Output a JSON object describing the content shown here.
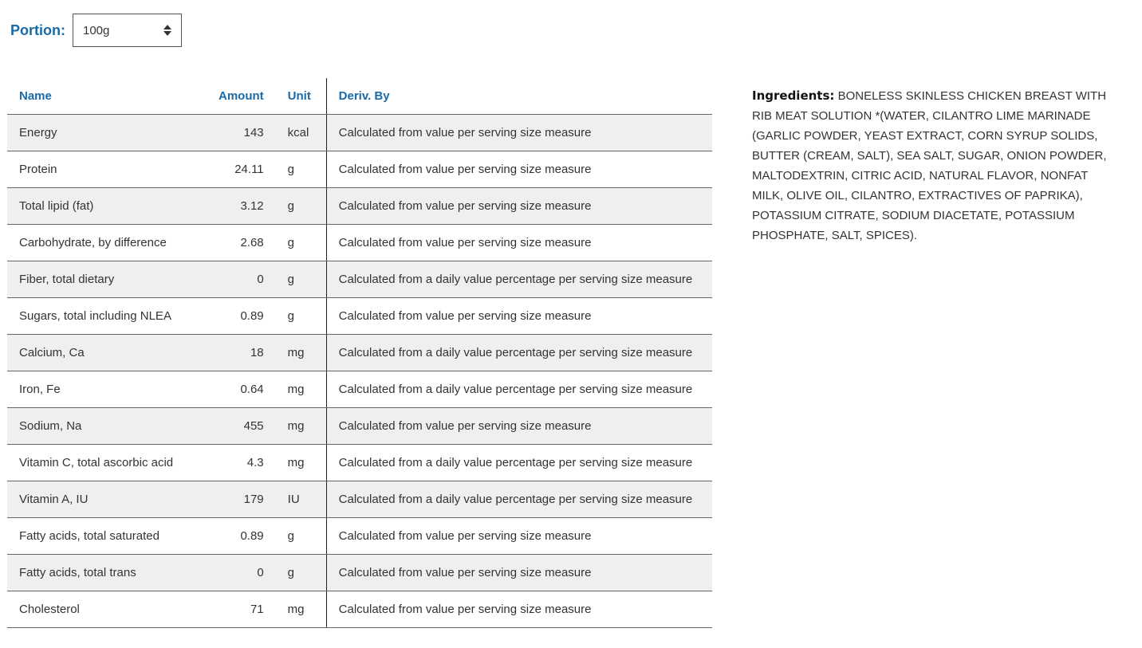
{
  "portion": {
    "label": "Portion:",
    "selected": "100g"
  },
  "table": {
    "headers": {
      "name": "Name",
      "amount": "Amount",
      "unit": "Unit",
      "deriv": "Deriv. By"
    },
    "rows": [
      {
        "name": "Energy",
        "amount": "143",
        "unit": "kcal",
        "deriv": "Calculated from value per serving size measure"
      },
      {
        "name": "Protein",
        "amount": "24.11",
        "unit": "g",
        "deriv": "Calculated from value per serving size measure"
      },
      {
        "name": "Total lipid (fat)",
        "amount": "3.12",
        "unit": "g",
        "deriv": "Calculated from value per serving size measure"
      },
      {
        "name": "Carbohydrate, by difference",
        "amount": "2.68",
        "unit": "g",
        "deriv": "Calculated from value per serving size measure"
      },
      {
        "name": "Fiber, total dietary",
        "amount": "0",
        "unit": "g",
        "deriv": "Calculated from a daily value percentage per serving size measure"
      },
      {
        "name": "Sugars, total including NLEA",
        "amount": "0.89",
        "unit": "g",
        "deriv": "Calculated from value per serving size measure"
      },
      {
        "name": "Calcium, Ca",
        "amount": "18",
        "unit": "mg",
        "deriv": "Calculated from a daily value percentage per serving size measure"
      },
      {
        "name": "Iron, Fe",
        "amount": "0.64",
        "unit": "mg",
        "deriv": "Calculated from a daily value percentage per serving size measure"
      },
      {
        "name": "Sodium, Na",
        "amount": "455",
        "unit": "mg",
        "deriv": "Calculated from value per serving size measure"
      },
      {
        "name": "Vitamin C, total ascorbic acid",
        "amount": "4.3",
        "unit": "mg",
        "deriv": "Calculated from a daily value percentage per serving size measure"
      },
      {
        "name": "Vitamin A, IU",
        "amount": "179",
        "unit": "IU",
        "deriv": "Calculated from a daily value percentage per serving size measure"
      },
      {
        "name": "Fatty acids, total saturated",
        "amount": "0.89",
        "unit": "g",
        "deriv": "Calculated from value per serving size measure"
      },
      {
        "name": "Fatty acids, total trans",
        "amount": "0",
        "unit": "g",
        "deriv": "Calculated from value per serving size measure"
      },
      {
        "name": "Cholesterol",
        "amount": "71",
        "unit": "mg",
        "deriv": "Calculated from value per serving size measure"
      }
    ]
  },
  "ingredients": {
    "label": "Ingredients:",
    "text": "BONELESS SKINLESS CHICKEN BREAST WITH RIB MEAT SOLUTION *(WATER, CILANTRO LIME MARINADE (GARLIC POWDER, YEAST EXTRACT, CORN SYRUP SOLIDS, BUTTER (CREAM, SALT), SEA SALT, SUGAR, ONION POWDER, MALTODEXTRIN, CITRIC ACID, NATURAL FLAVOR, NONFAT MILK, OLIVE OIL, CILANTRO, EXTRACTIVES OF PAPRIKA), POTASSIUM CITRATE, SODIUM DIACETATE, POTASSIUM PHOSPHATE, SALT, SPICES)."
  },
  "colors": {
    "accent": "#1a6aa8",
    "row_stripe": "#efefef"
  }
}
